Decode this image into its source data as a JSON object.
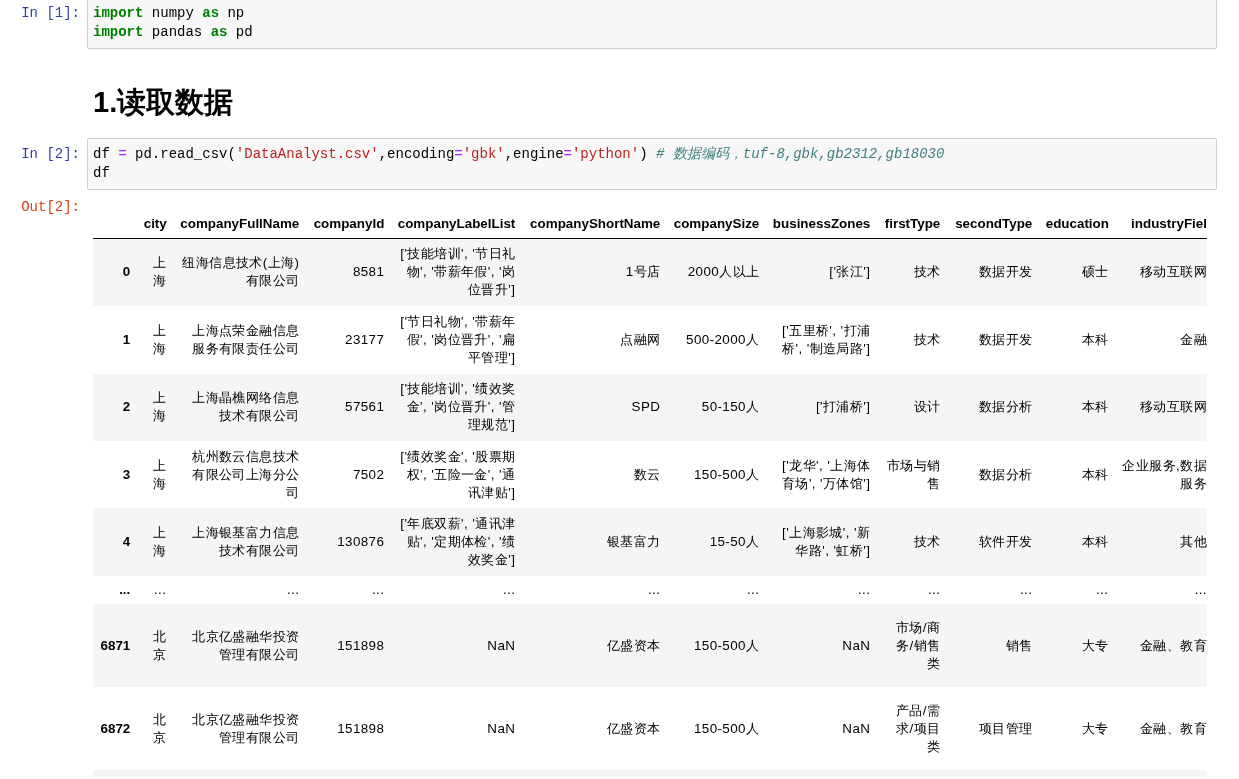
{
  "cells": [
    {
      "kind": "code",
      "prompt": "In [1]:",
      "lines": [
        [
          {
            "kind": "keyword",
            "text": "import"
          },
          {
            "kind": "plain",
            "text": " numpy "
          },
          {
            "kind": "keyword",
            "text": "as"
          },
          {
            "kind": "plain",
            "text": " np"
          }
        ],
        [
          {
            "kind": "keyword",
            "text": "import"
          },
          {
            "kind": "plain",
            "text": " pandas "
          },
          {
            "kind": "keyword",
            "text": "as"
          },
          {
            "kind": "plain",
            "text": " pd"
          }
        ]
      ]
    },
    {
      "kind": "markdown",
      "heading": "1.读取数据"
    },
    {
      "kind": "code",
      "prompt": "In [2]:",
      "lines": [
        [
          {
            "kind": "plain",
            "text": "df "
          },
          {
            "kind": "operator",
            "text": "="
          },
          {
            "kind": "plain",
            "text": " pd.read_csv("
          },
          {
            "kind": "string",
            "text": "'DataAnalyst.csv'"
          },
          {
            "kind": "plain",
            "text": ",encoding"
          },
          {
            "kind": "operator",
            "text": "="
          },
          {
            "kind": "string",
            "text": "'gbk'"
          },
          {
            "kind": "plain",
            "text": ",engine"
          },
          {
            "kind": "operator",
            "text": "="
          },
          {
            "kind": "string",
            "text": "'python'"
          },
          {
            "kind": "plain",
            "text": ") "
          },
          {
            "kind": "comment",
            "text": "# 数据编码，tuf-8,gbk,gb2312,gb18030"
          }
        ],
        [
          {
            "kind": "plain",
            "text": "df"
          }
        ]
      ],
      "output": {
        "prompt": "Out[2]:",
        "table": {
          "columns": [
            "city",
            "companyFullName",
            "companyId",
            "companyLabelList",
            "companyShortName",
            "companySize",
            "businessZones",
            "firstType",
            "secondType",
            "education",
            "industryFiel"
          ],
          "rows": [
            {
              "kind": "data",
              "index": "0",
              "cells": [
                "上海",
                "纽海信息技术(上海)有限公司",
                "8581",
                "['技能培训', '节日礼物', '带薪年假', '岗位晋升']",
                "1号店",
                "2000人以上",
                "['张江']",
                "技术",
                "数据开发",
                "硕士",
                "移动互联网"
              ]
            },
            {
              "kind": "data",
              "index": "1",
              "cells": [
                "上海",
                "上海点荣金融信息服务有限责任公司",
                "23177",
                "['节日礼物', '带薪年假', '岗位晋升', '扁平管理']",
                "点融网",
                "500-2000人",
                "['五里桥', '打浦桥', '制造局路']",
                "技术",
                "数据开发",
                "本科",
                "金融"
              ]
            },
            {
              "kind": "data",
              "index": "2",
              "cells": [
                "上海",
                "上海晶樵网络信息技术有限公司",
                "57561",
                "['技能培训', '绩效奖金', '岗位晋升', '管理规范']",
                "SPD",
                "50-150人",
                "['打浦桥']",
                "设计",
                "数据分析",
                "本科",
                "移动互联网"
              ]
            },
            {
              "kind": "data",
              "index": "3",
              "cells": [
                "上海",
                "杭州数云信息技术有限公司上海分公司",
                "7502",
                "['绩效奖金', '股票期权', '五险一金', '通讯津贴']",
                "数云",
                "150-500人",
                "['龙华', '上海体育场', '万体馆']",
                "市场与销售",
                "数据分析",
                "本科",
                "企业服务,数据服务"
              ]
            },
            {
              "kind": "data",
              "index": "4",
              "cells": [
                "上海",
                "上海银基富力信息技术有限公司",
                "130876",
                "['年底双薪', '通讯津贴', '定期体检', '绩效奖金']",
                "银基富力",
                "15-50人",
                "['上海影城', '新华路', '虹桥']",
                "技术",
                "软件开发",
                "本科",
                "其他"
              ]
            },
            {
              "kind": "ellipsis",
              "index": "...",
              "cells": [
                "...",
                "...",
                "...",
                "...",
                "...",
                "...",
                "...",
                "...",
                "...",
                "...",
                "..."
              ]
            },
            {
              "kind": "data",
              "index": "6871",
              "cells": [
                "北京",
                "北京亿盛融华投资管理有限公司",
                "151898",
                "NaN",
                "亿盛资本",
                "150-500人",
                "NaN",
                "市场/商务/销售类",
                "销售",
                "大专",
                "金融、教育"
              ]
            },
            {
              "kind": "data",
              "index": "6872",
              "cells": [
                "北京",
                "北京亿盛融华投资管理有限公司",
                "151898",
                "NaN",
                "亿盛资本",
                "150-500人",
                "NaN",
                "产品/需求/项目类",
                "项目管理",
                "大专",
                "金融、教育"
              ]
            }
          ]
        }
      }
    }
  ]
}
